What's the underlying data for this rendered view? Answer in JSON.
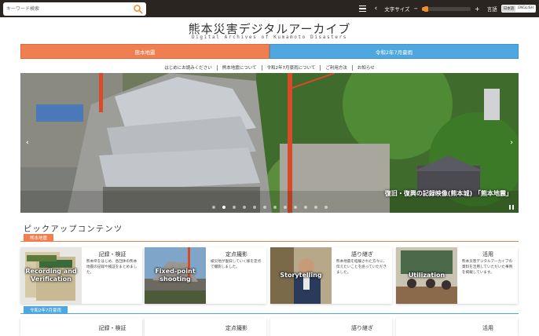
{
  "search": {
    "placeholder": "キーワード検索"
  },
  "toolbar": {
    "font_size_label": "文字サイズ",
    "font_size_level": 0.05,
    "minus": "−",
    "plus": "+",
    "lang_label": "言語",
    "lang_options": [
      "日本語",
      "ENGLISH"
    ],
    "prev": "‹"
  },
  "header": {
    "title": "熊本災害デジタルアーカイブ",
    "subtitle": "Digital Archives of Kumamoto Disasters"
  },
  "tabs": [
    {
      "label": "熊本地震",
      "color": "#ef7e50"
    },
    {
      "label": "令和2年7月豪雨",
      "color": "#4ea7df"
    }
  ],
  "nav": [
    "はじめにお読みください",
    "熊本地震について",
    "令和2年7月豪雨について",
    "ご利用方法",
    "お知らせ"
  ],
  "hero": {
    "caption": "復旧・復興の記録映像(熊本城) 「熊本地震」",
    "prev": "‹",
    "next": "›",
    "slide_count": 12,
    "active_slide": 1
  },
  "pickup": {
    "title": "ピックアップコンテンツ",
    "categories": [
      {
        "label": "熊本地震",
        "cards": [
          {
            "title": "記録・検証",
            "overlay": "Recording and Verification",
            "desc": "熊本県をはじめ、各団体の熊本地震の記録や検証をまとめました。"
          },
          {
            "title": "定点撮影",
            "overlay": "Fixed-point shooting",
            "desc": "被災地が復旧していく様を定点で撮影しました。"
          },
          {
            "title": "語り継ぎ",
            "overlay": "Storytelling",
            "desc": "熊本地震を経験された方々に、伝えたいことを語っていただきました。"
          },
          {
            "title": "活用",
            "overlay": "Utilization",
            "desc": "熊本災害デジタルアーカイブの資料を活用していただいた事例を掲載しています。"
          }
        ]
      },
      {
        "label": "令和2年7月豪雨",
        "cards": [
          {
            "title": "記録・検証"
          },
          {
            "title": "定点撮影"
          },
          {
            "title": "語り継ぎ"
          },
          {
            "title": "活用"
          }
        ]
      }
    ]
  }
}
